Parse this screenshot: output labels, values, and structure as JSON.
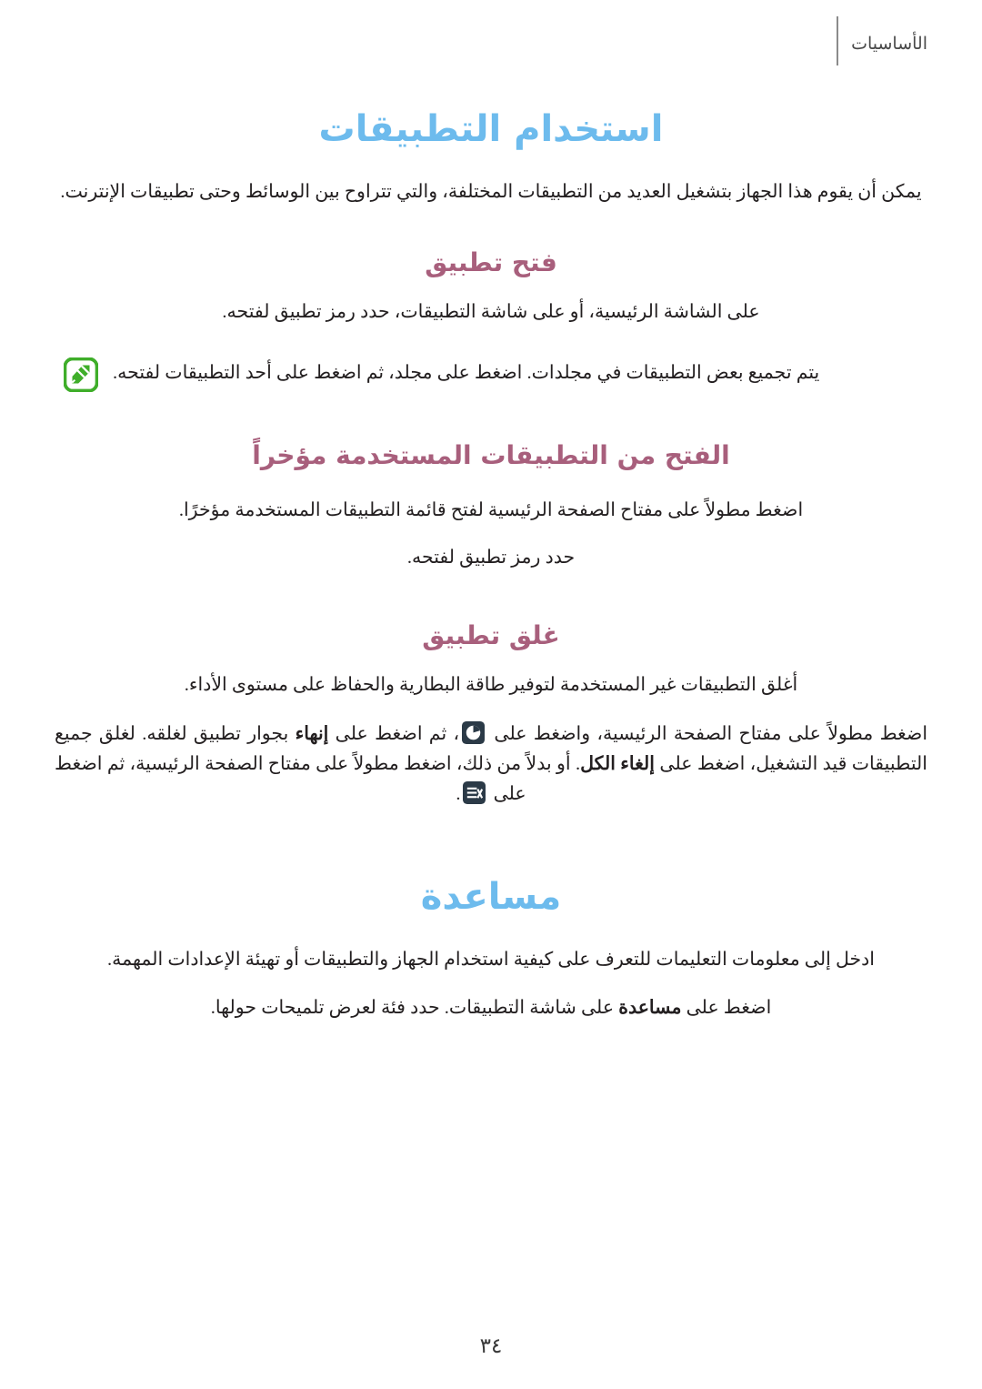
{
  "header": {
    "section_title": "الأساسيات"
  },
  "colors": {
    "h1_blue": "#6dbbed",
    "h2_mauve": "#a85f7c",
    "note_icon_green": "#3fae2a",
    "inline_icon_navy": "#2b3a47",
    "body_text": "#231f20"
  },
  "main": {
    "title": "استخدام التطبيقات",
    "intro": "يمكن أن يقوم هذا الجهاز بتشغيل العديد من التطبيقات المختلفة، والتي تتراوح بين الوسائط وحتى تطبيقات الإنترنت.",
    "sections": [
      {
        "heading": "فتح تطبيق",
        "paragraph": "على الشاشة الرئيسية، أو على شاشة التطبيقات، حدد رمز تطبيق لفتحه.",
        "note": {
          "icon": "note-pen-icon",
          "text": "يتم تجميع بعض التطبيقات في مجلدات. اضغط على مجلد، ثم اضغط على أحد التطبيقات لفتحه."
        }
      },
      {
        "heading": "الفتح من التطبيقات المستخدمة مؤخراً",
        "line1": "اضغط مطولاً على مفتاح الصفحة الرئيسية لفتح قائمة التطبيقات المستخدمة مؤخرًا.",
        "line2": "حدد رمز تطبيق لفتحه."
      },
      {
        "heading": "غلق تطبيق",
        "paragraph": "أغلق التطبيقات غير المستخدمة لتوفير طاقة البطارية والحفاظ على مستوى الأداء.",
        "instruction": {
          "part1": "اضغط مطولاً على مفتاح الصفحة الرئيسية، واضغط على",
          "icon1": "task-manager-icon",
          "part2": "، ثم اضغط على",
          "bold1": "إنهاء",
          "part3": "بجوار تطبيق لغلقه. لغلق جميع التطبيقات قيد التشغيل، اضغط على",
          "bold2": "إلغاء الكل",
          "part4": ". أو بدلاً من ذلك، اضغط مطولاً على مفتاح الصفحة الرئيسية، ثم اضغط على",
          "icon2": "close-all-apps-icon",
          "part5": "."
        }
      }
    ],
    "help": {
      "heading": "مساعدة",
      "line1": "ادخل إلى معلومات التعليمات للتعرف على كيفية استخدام الجهاز والتطبيقات أو تهيئة الإعدادات المهمة.",
      "line2_pre": "اضغط على",
      "line2_bold": "مساعدة",
      "line2_post": "على شاشة التطبيقات. حدد فئة لعرض تلميحات حولها."
    }
  },
  "footer": {
    "page_number": "٣٤"
  }
}
